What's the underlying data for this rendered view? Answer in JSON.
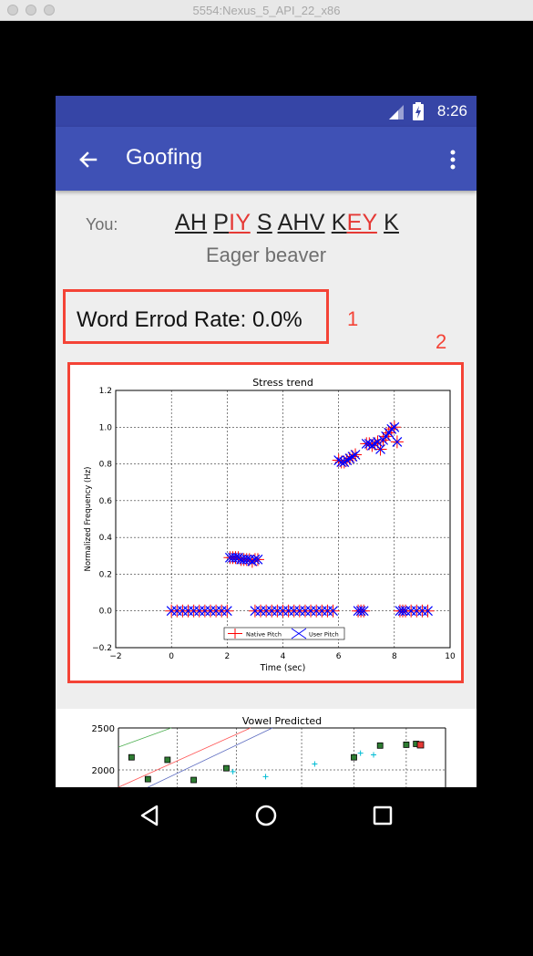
{
  "window": {
    "title": "5554:Nexus_5_API_22_x86"
  },
  "status_bar": {
    "time": "8:26"
  },
  "app_bar": {
    "title": "Goofing",
    "back_icon": "arrow-back-icon",
    "menu_icon": "more-vert-icon"
  },
  "speaker": {
    "label": "You:"
  },
  "phonemes": [
    {
      "text": "AH",
      "error": false
    },
    {
      "text": "P",
      "error": false
    },
    {
      "text": "IY",
      "error": true
    },
    {
      "text": "S",
      "error": false
    },
    {
      "text": "AHV",
      "error": false
    },
    {
      "text": "K",
      "error": false
    },
    {
      "text": "EY",
      "error": true
    },
    {
      "text": "K",
      "error": false
    }
  ],
  "phrase": "Eager beaver",
  "word_error_rate": {
    "text": "Word Errod Rate: 0.0%"
  },
  "annotations": {
    "label_1": "1",
    "label_2": "2"
  },
  "colors": {
    "primary": "#3f51b5",
    "primary_dark": "#3645a6",
    "annotation": "#f44336",
    "error_phoneme": "#e53935",
    "native": "#ff0000",
    "user": "#0000ff"
  },
  "chart_data": [
    {
      "type": "scatter",
      "title": "Stress trend",
      "xlabel": "Time (sec)",
      "ylabel": "Normalized Frequency (Hz)",
      "xlim": [
        -2,
        10
      ],
      "ylim": [
        -0.2,
        1.2
      ],
      "xticks": [
        -2,
        0,
        2,
        4,
        6,
        8,
        10
      ],
      "yticks": [
        -0.2,
        0.0,
        0.2,
        0.4,
        0.6,
        0.8,
        1.0,
        1.2
      ],
      "grid": true,
      "legend": "bottom-center",
      "series": [
        {
          "name": "Native Pitch",
          "marker": "plus",
          "color": "#ff0000",
          "x": [
            0.0,
            0.2,
            0.4,
            0.6,
            0.8,
            1.0,
            1.2,
            1.4,
            1.6,
            1.8,
            2.0,
            2.1,
            2.2,
            2.3,
            2.4,
            2.5,
            2.6,
            2.7,
            2.8,
            2.9,
            3.0,
            3.1,
            3.0,
            3.2,
            3.4,
            3.6,
            3.8,
            4.0,
            4.2,
            4.4,
            4.6,
            4.8,
            5.0,
            5.2,
            5.4,
            5.6,
            5.8,
            6.0,
            6.1,
            6.2,
            6.3,
            6.4,
            6.5,
            6.6,
            6.7,
            6.8,
            6.9,
            7.0,
            7.1,
            7.2,
            7.3,
            7.4,
            7.5,
            7.6,
            7.7,
            7.8,
            7.9,
            8.0,
            8.1,
            8.2,
            8.3,
            8.4,
            8.6,
            8.8,
            9.0,
            9.2
          ],
          "y": [
            0.0,
            0.0,
            0.0,
            0.0,
            0.0,
            0.0,
            0.0,
            0.0,
            0.0,
            0.0,
            0.0,
            0.29,
            0.29,
            0.29,
            0.29,
            0.28,
            0.28,
            0.28,
            0.28,
            0.27,
            0.28,
            0.28,
            0.0,
            0.0,
            0.0,
            0.0,
            0.0,
            0.0,
            0.0,
            0.0,
            0.0,
            0.0,
            0.0,
            0.0,
            0.0,
            0.0,
            0.0,
            0.82,
            0.81,
            0.81,
            0.82,
            0.83,
            0.84,
            0.85,
            0.0,
            0.0,
            0.0,
            0.91,
            0.91,
            0.9,
            0.91,
            0.92,
            0.88,
            0.93,
            0.95,
            0.97,
            0.99,
            1.0,
            0.92,
            0.0,
            0.0,
            0.0,
            0.0,
            0.0,
            0.0,
            0.0
          ]
        },
        {
          "name": "User Pitch",
          "marker": "x",
          "color": "#0000ff",
          "x": [
            0.0,
            0.2,
            0.4,
            0.6,
            0.8,
            1.0,
            1.2,
            1.4,
            1.6,
            1.8,
            2.0,
            2.1,
            2.2,
            2.3,
            2.4,
            2.5,
            2.6,
            2.7,
            2.8,
            2.9,
            3.0,
            3.1,
            3.0,
            3.2,
            3.4,
            3.6,
            3.8,
            4.0,
            4.2,
            4.4,
            4.6,
            4.8,
            5.0,
            5.2,
            5.4,
            5.6,
            5.8,
            6.0,
            6.1,
            6.2,
            6.3,
            6.4,
            6.5,
            6.6,
            6.7,
            6.8,
            6.9,
            7.0,
            7.1,
            7.2,
            7.3,
            7.4,
            7.5,
            7.6,
            7.7,
            7.8,
            7.9,
            8.0,
            8.1,
            8.2,
            8.3,
            8.4,
            8.6,
            8.8,
            9.0,
            9.2
          ],
          "y": [
            0.0,
            0.0,
            0.0,
            0.0,
            0.0,
            0.0,
            0.0,
            0.0,
            0.0,
            0.0,
            0.0,
            0.29,
            0.29,
            0.29,
            0.29,
            0.28,
            0.28,
            0.28,
            0.28,
            0.27,
            0.28,
            0.28,
            0.0,
            0.0,
            0.0,
            0.0,
            0.0,
            0.0,
            0.0,
            0.0,
            0.0,
            0.0,
            0.0,
            0.0,
            0.0,
            0.0,
            0.0,
            0.82,
            0.81,
            0.81,
            0.82,
            0.83,
            0.84,
            0.85,
            0.0,
            0.0,
            0.0,
            0.91,
            0.91,
            0.9,
            0.91,
            0.92,
            0.88,
            0.93,
            0.95,
            0.97,
            0.99,
            1.0,
            0.92,
            0.0,
            0.0,
            0.0,
            0.0,
            0.0,
            0.0,
            0.0
          ]
        }
      ]
    },
    {
      "type": "scatter",
      "title": "Vowel Predicted",
      "ylim": [
        1800,
        2500
      ],
      "yticks": [
        2000,
        2500
      ],
      "grid": true,
      "series": [
        {
          "marker": "square",
          "color": "#2e7d32",
          "x": [
            0.04,
            0.09,
            0.15,
            0.23,
            0.33,
            0.72,
            0.8,
            0.88,
            0.91
          ],
          "y": [
            2150,
            1890,
            2120,
            1880,
            2020,
            2150,
            2290,
            2300,
            2310
          ]
        },
        {
          "marker": "plus",
          "color": "#00bcd4",
          "x": [
            0.35,
            0.45,
            0.6,
            0.74,
            0.78
          ],
          "y": [
            1980,
            1920,
            2070,
            2200,
            2180
          ]
        }
      ]
    }
  ]
}
